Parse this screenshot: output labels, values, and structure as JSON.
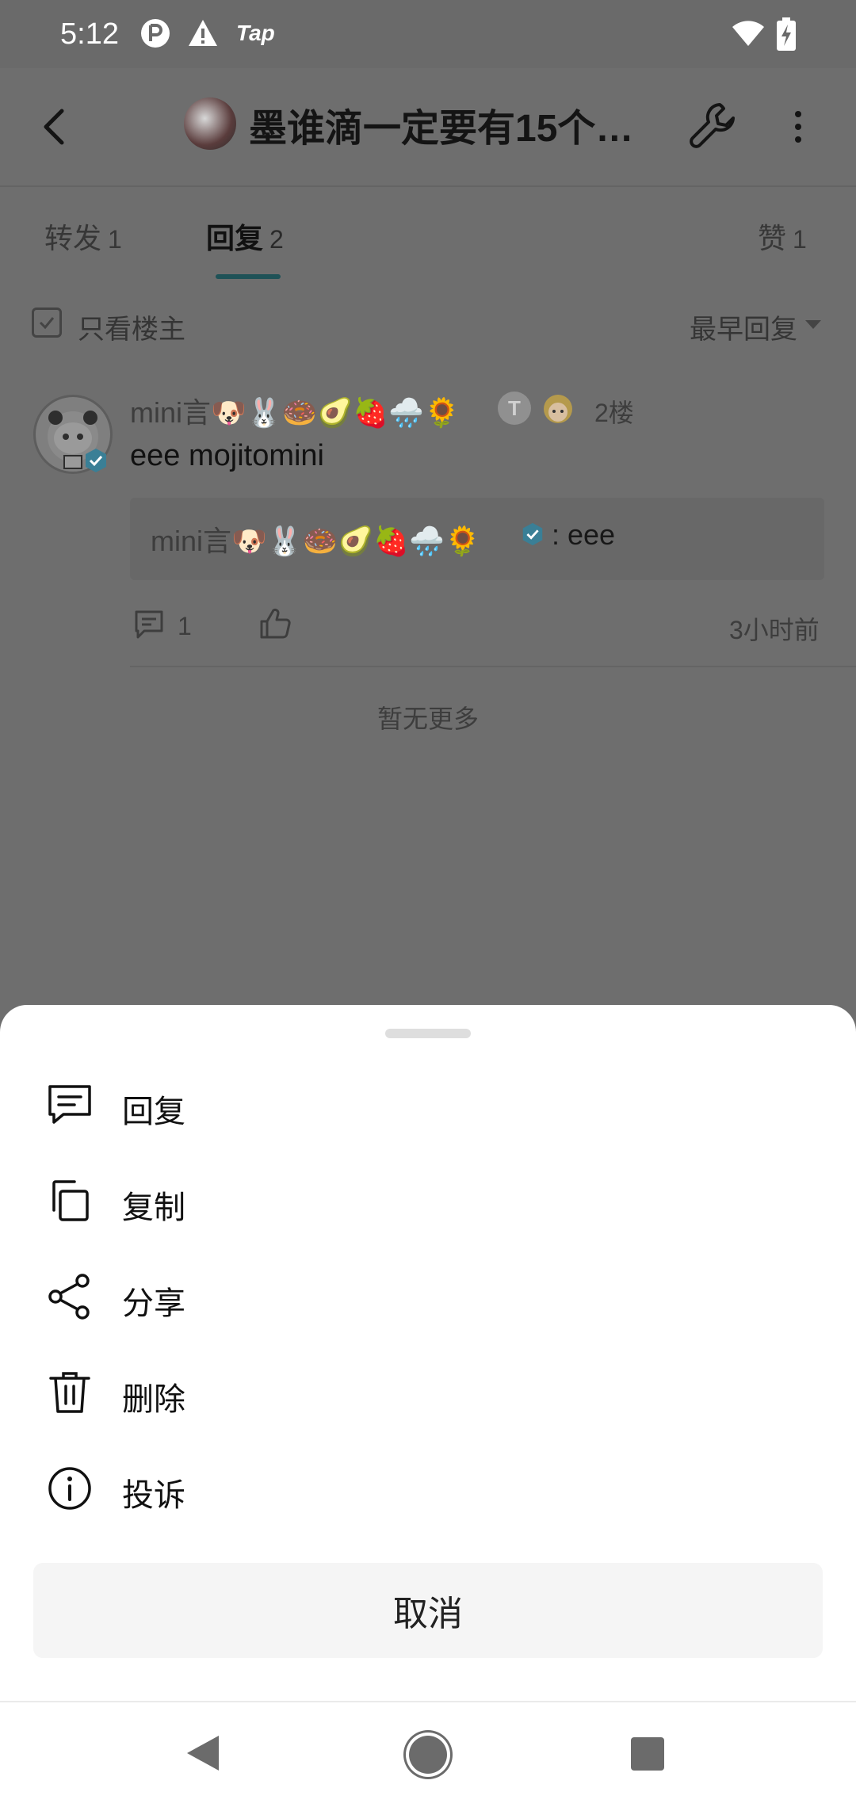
{
  "status_bar": {
    "time": "5:12",
    "tap_label": "Tap",
    "icons": [
      "app-notification-icon",
      "warning-icon",
      "wifi-icon",
      "battery-charging-icon"
    ]
  },
  "header": {
    "title": "墨谁滴一定要有15个…",
    "icons": [
      "back-arrow-icon",
      "group-avatar",
      "wrench-icon",
      "more-vertical-icon"
    ]
  },
  "tabs": [
    {
      "label": "转发",
      "count": "1"
    },
    {
      "label": "回复",
      "count": "2"
    },
    {
      "label": "赞",
      "count": "1"
    }
  ],
  "filter": {
    "only_owner_label": "只看楼主",
    "sort_label": "最早回复"
  },
  "comment": {
    "username": "mini言🐶🐰🍩🥑🍓🌧️🌻",
    "floor": "2楼",
    "text": "eee mojitomini",
    "quote_user": "mini言🐶🐰🍩🥑🍓🌧️🌻",
    "quote_text": ": eee",
    "reply_count": "1",
    "time": "3小时前"
  },
  "no_more": "暂无更多",
  "sheet": {
    "items": [
      {
        "label": "回复",
        "icon": "reply-icon"
      },
      {
        "label": "复制",
        "icon": "copy-icon"
      },
      {
        "label": "分享",
        "icon": "share-icon"
      },
      {
        "label": "删除",
        "icon": "trash-icon"
      },
      {
        "label": "投诉",
        "icon": "info-icon"
      }
    ],
    "cancel_label": "取消"
  },
  "colors": {
    "scrim": "#6e6e6e",
    "accent_underline": "#1f5257",
    "sheet_bg": "#ffffff",
    "cancel_bg": "#f5f5f5",
    "verified": "#3a7f96"
  }
}
